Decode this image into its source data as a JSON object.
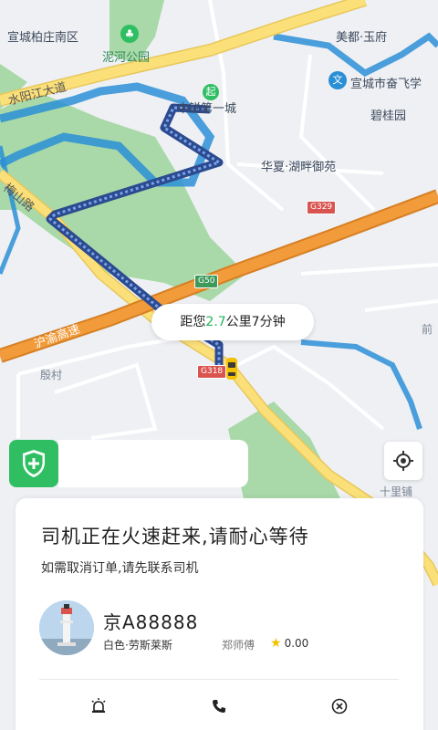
{
  "map": {
    "labels": {
      "district_nw": "宣城柏庄南区",
      "park": "泥河公园",
      "area_ne": "美都·玉府",
      "poi_school": "宣城市奋飞学",
      "road_water": "水阳江大道",
      "start_place": "中锐第一城",
      "area_right": "碧桂园",
      "community": "华夏·湖畔御苑",
      "road_left": "梅山路",
      "highway": "沪渝高速",
      "village": "殷村",
      "right_edge": "前",
      "town": "十里铺"
    },
    "shields": {
      "g329": "G329",
      "g50": "G50",
      "g318": "G318"
    },
    "start_marker": "起",
    "school_marker": "文",
    "colors": {
      "route": "#3b5ea8",
      "highway": "#f29b3b",
      "main_road": "#fbe07a",
      "water": "#2b8fd6",
      "park_green": "#a9d9a8"
    }
  },
  "eta_bubble": {
    "prefix": "距您",
    "distance": "2.7",
    "suffix": "公里7分钟"
  },
  "card": {
    "title": "司机正在火速赶来,请耐心等待",
    "subtitle": "如需取消订单,请先联系司机",
    "plate": "京A88888",
    "car_desc": "白色·劳斯莱斯",
    "driver_name": "郑师傅",
    "rating": "0.00"
  },
  "icons": {
    "safety": "shield-plus-icon",
    "locate": "locate-icon",
    "alarm": "alarm-icon",
    "phone": "phone-icon",
    "cancel": "cancel-icon"
  }
}
